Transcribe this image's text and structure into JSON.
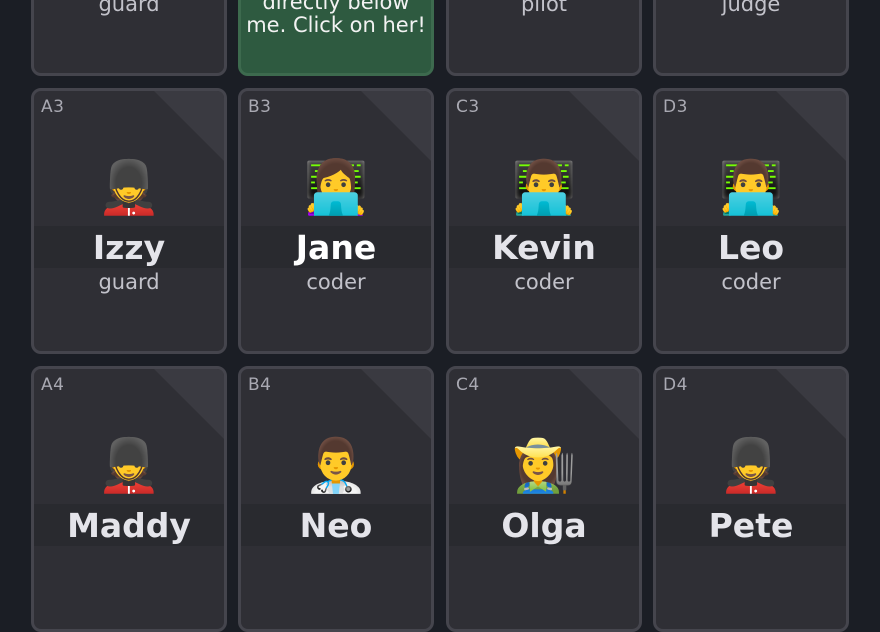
{
  "rows": [
    [
      {
        "coord": "",
        "avatar": "",
        "name": "",
        "role": "guard"
      },
      {
        "hint_lines": [
          "directly below",
          "me. Click on her!"
        ]
      },
      {
        "coord": "",
        "avatar": "",
        "name": "",
        "role": "pilot"
      },
      {
        "coord": "",
        "avatar": "",
        "name": "",
        "role": "judge"
      }
    ],
    [
      {
        "coord": "A3",
        "avatar": "💂",
        "name": "Izzy",
        "role": "guard"
      },
      {
        "coord": "B3",
        "avatar": "👩‍💻",
        "name": "Jane",
        "role": "coder"
      },
      {
        "coord": "C3",
        "avatar": "👨‍💻",
        "name": "Kevin",
        "role": "coder"
      },
      {
        "coord": "D3",
        "avatar": "👨‍💻",
        "name": "Leo",
        "role": "coder"
      }
    ],
    [
      {
        "coord": "A4",
        "avatar": "💂",
        "name": "Maddy",
        "role": ""
      },
      {
        "coord": "B4",
        "avatar": "👨‍⚕️",
        "name": "Neo",
        "role": ""
      },
      {
        "coord": "C4",
        "avatar": "👩‍🌾",
        "name": "Olga",
        "role": ""
      },
      {
        "coord": "D4",
        "avatar": "💂",
        "name": "Pete",
        "role": ""
      }
    ]
  ]
}
